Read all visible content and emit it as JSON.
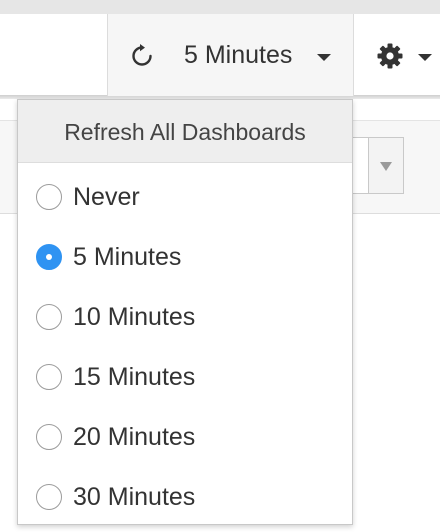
{
  "toolbar": {
    "refresh": {
      "icon": "refresh-icon",
      "label": "5 Minutes"
    },
    "settings": {
      "icon": "gear-icon"
    }
  },
  "refresh_menu": {
    "title": "Refresh All Dashboards",
    "selected": "5 Minutes",
    "options": [
      {
        "label": "Never",
        "checked": false
      },
      {
        "label": "5 Minutes",
        "checked": true
      },
      {
        "label": "10 Minutes",
        "checked": false
      },
      {
        "label": "15 Minutes",
        "checked": false
      },
      {
        "label": "20 Minutes",
        "checked": false
      },
      {
        "label": "30 Minutes",
        "checked": false
      }
    ]
  },
  "colors": {
    "accent": "#2f93f2",
    "text": "#333333",
    "header_bg": "#eeeeee",
    "toolbar_button_bg": "#f6f6f6"
  }
}
